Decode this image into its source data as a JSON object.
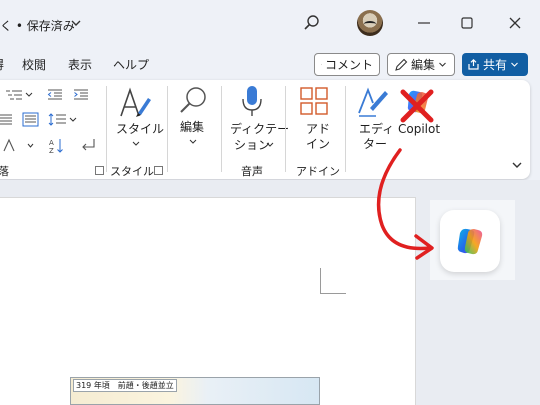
{
  "titlebar": {
    "title": "• 保存済み",
    "title_prefix": "く"
  },
  "menu": {
    "tabs": [
      "校閲",
      "表示",
      "ヘルプ"
    ],
    "cut_tab": "得"
  },
  "actions": {
    "comment_label": "コメント",
    "edit_label": "編集",
    "share_label": "共有"
  },
  "ribbon": {
    "style_label": "スタイル",
    "edit_label": "編集",
    "dictate_label_1": "ディクテー",
    "dictate_label_2": "ション",
    "addin_label_1": "アド",
    "addin_label_2": "イン",
    "editor_label_1": "エディ",
    "editor_label_2": "ター",
    "copilot_label": "Copilot",
    "groups": {
      "paragraph": "落",
      "style": "スタイル",
      "voice": "音声",
      "addin": "アドイン"
    }
  },
  "document": {
    "map_caption": "319 年頃　前趙・後趙並立"
  },
  "colors": {
    "share_blue": "#115ea3",
    "annotation_red": "#e02020"
  }
}
